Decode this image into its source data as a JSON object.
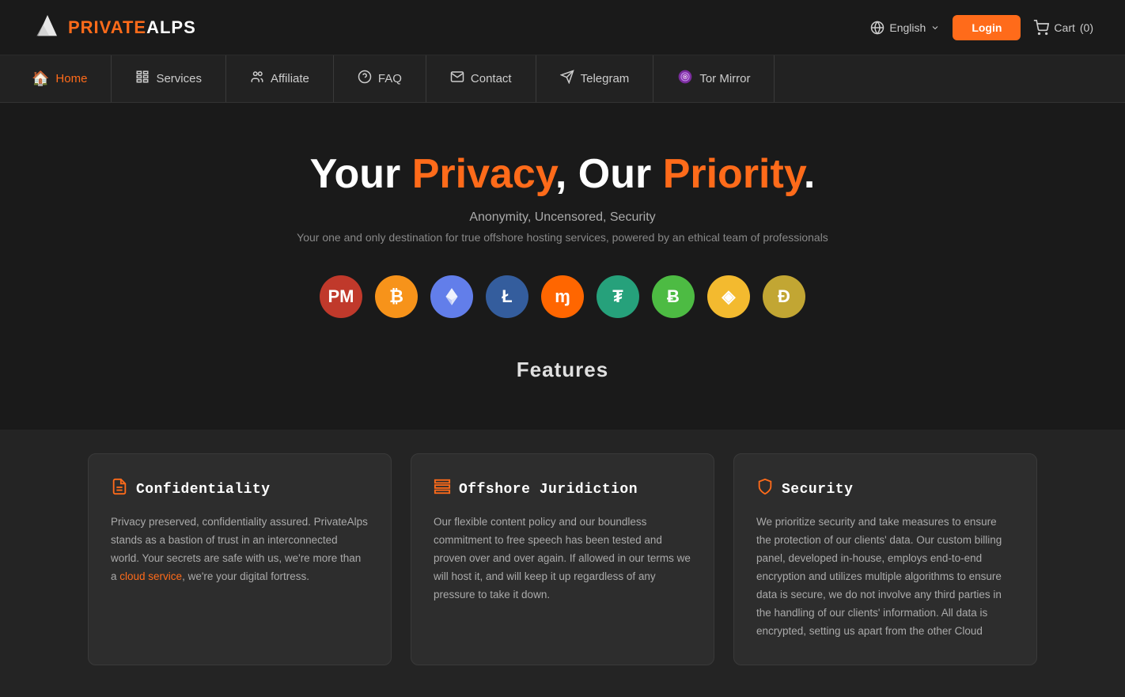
{
  "header": {
    "logo_text_main": "PRIVATE",
    "logo_text_sub": "ALPS",
    "language_label": "English",
    "login_label": "Login",
    "cart_label": "Cart",
    "cart_count": "(0)"
  },
  "nav": {
    "items": [
      {
        "id": "home",
        "label": "Home",
        "icon": "🏠",
        "active": true
      },
      {
        "id": "services",
        "label": "Services",
        "icon": "☰",
        "active": false
      },
      {
        "id": "affiliate",
        "label": "Affiliate",
        "icon": "👥",
        "active": false
      },
      {
        "id": "faq",
        "label": "FAQ",
        "icon": "❓",
        "active": false
      },
      {
        "id": "contact",
        "label": "Contact",
        "icon": "✉",
        "active": false
      },
      {
        "id": "telegram",
        "label": "Telegram",
        "icon": "✈",
        "active": false
      },
      {
        "id": "tor-mirror",
        "label": "Tor Mirror",
        "icon": "🌐",
        "active": false
      }
    ]
  },
  "hero": {
    "title_start": "Your ",
    "title_highlight1": "Privacy",
    "title_middle": ", Our ",
    "title_highlight2": "Priority",
    "title_end": ".",
    "subtitle": "Anonymity, Uncensored, Security",
    "description": "Your one and only destination for true offshore hosting services, powered by an ethical team of professionals"
  },
  "crypto": {
    "coins": [
      {
        "id": "pm",
        "label": "PM",
        "class": "crypto-pm",
        "title": "Perfect Money"
      },
      {
        "id": "btc",
        "label": "₿",
        "class": "crypto-btc",
        "title": "Bitcoin"
      },
      {
        "id": "eth",
        "label": "⟠",
        "class": "crypto-eth",
        "title": "Ethereum"
      },
      {
        "id": "ltc",
        "label": "Ł",
        "class": "crypto-ltc",
        "title": "Litecoin"
      },
      {
        "id": "xmr",
        "label": "ɱ",
        "class": "crypto-xmr",
        "title": "Monero"
      },
      {
        "id": "usdt",
        "label": "₮",
        "class": "crypto-usdt",
        "title": "Tether"
      },
      {
        "id": "bch",
        "label": "Ƀ",
        "class": "crypto-bch",
        "title": "Bitcoin Cash"
      },
      {
        "id": "bnb",
        "label": "◈",
        "class": "crypto-bnb",
        "title": "Binance Coin"
      },
      {
        "id": "doge",
        "label": "Ð",
        "class": "crypto-doge",
        "title": "Dogecoin"
      }
    ]
  },
  "features": {
    "section_title": "Features",
    "cards": [
      {
        "id": "confidentiality",
        "icon": "📄",
        "title": "Confidentiality",
        "text": "Privacy preserved, confidentiality assured. PrivateAlps stands as a bastion of trust in an interconnected world. Your secrets are safe with us, we're more than a cloud service, we're your digital fortress."
      },
      {
        "id": "offshore",
        "icon": "🧱",
        "title": "Offshore Juridiction",
        "text": "Our flexible content policy and our boundless commitment to free speech has been tested and proven over and over again. If allowed in our terms we will host it, and will keep it up regardless of any pressure to take it down."
      },
      {
        "id": "security",
        "icon": "🛡",
        "title": "Security",
        "text": "We prioritize security and take measures to ensure the protection of our clients' data. Our custom billing panel, developed in-house, employs end-to-end encryption and utilizes multiple algorithms to ensure data is secure, we do not involve any third parties in the handling of our clients' information. All data is encrypted, setting us apart from the other Cloud"
      }
    ]
  }
}
